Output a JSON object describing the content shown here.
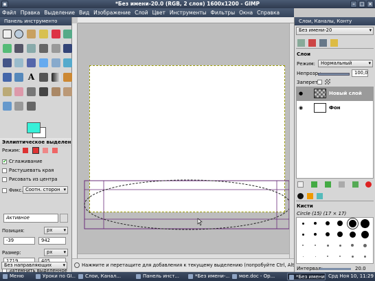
{
  "window": {
    "title": "*Без имени-20.0 (RGB, 2 слоя) 1600x1200 - GIMP"
  },
  "menu": [
    "Файл",
    "Правка",
    "Выделение",
    "Вид",
    "Изображение",
    "Слой",
    "Цвет",
    "Инструменты",
    "Фильтры",
    "Окна",
    "Справка"
  ],
  "toolbox": {
    "title": "Панель инструменто",
    "fg_color": "#36f0d8",
    "bg_color": "#ffffff",
    "options_title": "Эллиптическое выделение",
    "mode_label": "Режим:",
    "antialias_label": "Сглаживание",
    "feather_label": "Растушевать края",
    "from_center_label": "Рисовать из центра",
    "fixed_label": "Фикс.:",
    "fixed_value": "Соотн. сторон",
    "active_value": "Активное",
    "position_label": "Позиция:",
    "position_unit": "px",
    "pos_x": "-39",
    "pos_y": "942",
    "size_label": "Размер:",
    "size_unit": "px",
    "size_w": "1719",
    "size_h": "405",
    "highlight_label": "Затемнить выделенное",
    "guides_value": "Без направляющих"
  },
  "status": {
    "text": "Нажмите и перетащите для добавления к текущему выделению (попробуйте Ctrl, Alt)"
  },
  "dock": {
    "title": "Слои, Каналы, Конту",
    "image_select": "Без имени-20",
    "layers_label": "Слои",
    "mode_label": "Режим:",
    "mode_value": "Нормальный",
    "opacity_label": "Непрозр.:",
    "opacity_value": "100,0",
    "lock_label": "Запереть:",
    "layers": [
      {
        "name": "Новый слой",
        "selected": true
      },
      {
        "name": "Фон",
        "selected": false
      }
    ],
    "brushes_label": "Кисти",
    "brush_name": "Circle (15) (17 × 17)",
    "spacing_label": "Интервал:",
    "spacing_value": "20.0"
  },
  "taskbar": {
    "menu_label": "Меню",
    "items": [
      "Уроки по GI...",
      "Слои, Канал...",
      "Панель инст...",
      "*Без имени-...",
      "мое.doc - Ор...",
      "*Без имени-..."
    ],
    "clock": "Срд Ноя 10, 11:29"
  }
}
